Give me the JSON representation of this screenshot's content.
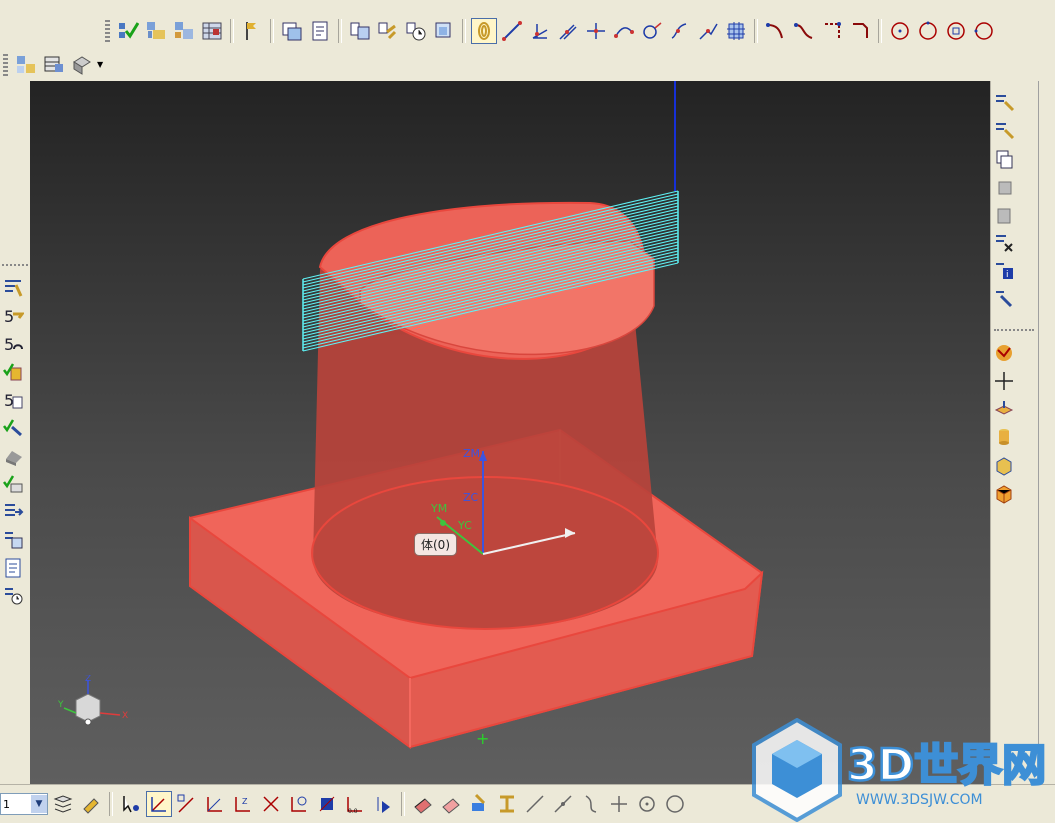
{
  "colors": {
    "toolbar_bg": "#ece9d8",
    "part_fill": "#f0655a",
    "part_edge": "#e9473d",
    "toolpath": "#5ef2f5",
    "axis_blue": "#2a4bd8",
    "axis_green": "#3ec43e",
    "axis_red": "#e03c3c",
    "watermark_blue": "#3d8fd6"
  },
  "viewport": {
    "tooltip": "体(0)",
    "csys_labels": {
      "zm": "ZM",
      "zc": "ZC",
      "ym": "YM",
      "yc": "YC"
    },
    "triad_labels": {
      "x": "X",
      "y": "Y",
      "z": "Z"
    }
  },
  "watermark": {
    "brand": "3D世界网",
    "url": "WWW.3DSJW.COM"
  },
  "bottom_bar": {
    "selector_value": "1"
  },
  "toolbar_icons": {
    "row2": [
      "verify-toolpath-icon",
      "generate-operation-icon",
      "program-order-icon",
      "machine-tool-icon",
      "create-marker-icon",
      "create-geometry-icon",
      "create-tool-icon",
      "create-method-icon",
      "post-process-icon",
      "list-icon",
      "spiral-icon"
    ],
    "row3": [
      "operation-navigator-icon",
      "machine-view-icon",
      "geometry-view-icon"
    ],
    "sketch_tools": [
      "line-icon",
      "axis-icon",
      "parallel-icon",
      "perpendicular-icon",
      "arc-icon",
      "circle-icon",
      "fillet-icon",
      "trim-icon",
      "grid-icon",
      "curve-icon",
      "spline-icon",
      "corner-icon",
      "circle-point-icon",
      "circle-center-icon",
      "circle-tangent-icon",
      "circle-three-point-icon"
    ]
  },
  "left_sidebar_icons": [
    "tool-path-edit-icon",
    "tool-settings-icon",
    "tool-path-replay-icon",
    "verify-icon",
    "list-tool-icon",
    "gouge-check-icon",
    "machine-icon",
    "feed-speed-icon",
    "post-icon",
    "doc-icon",
    "time-icon"
  ],
  "right_sidebar_icons": [
    "generate-icon",
    "replay-icon",
    "copy-icon",
    "cut-icon",
    "paste-icon",
    "delete-icon",
    "info-icon",
    "display-icon",
    "shaded-icon",
    "point-icon",
    "plane-icon",
    "cylinder-icon",
    "block-icon",
    "cube-icon"
  ]
}
